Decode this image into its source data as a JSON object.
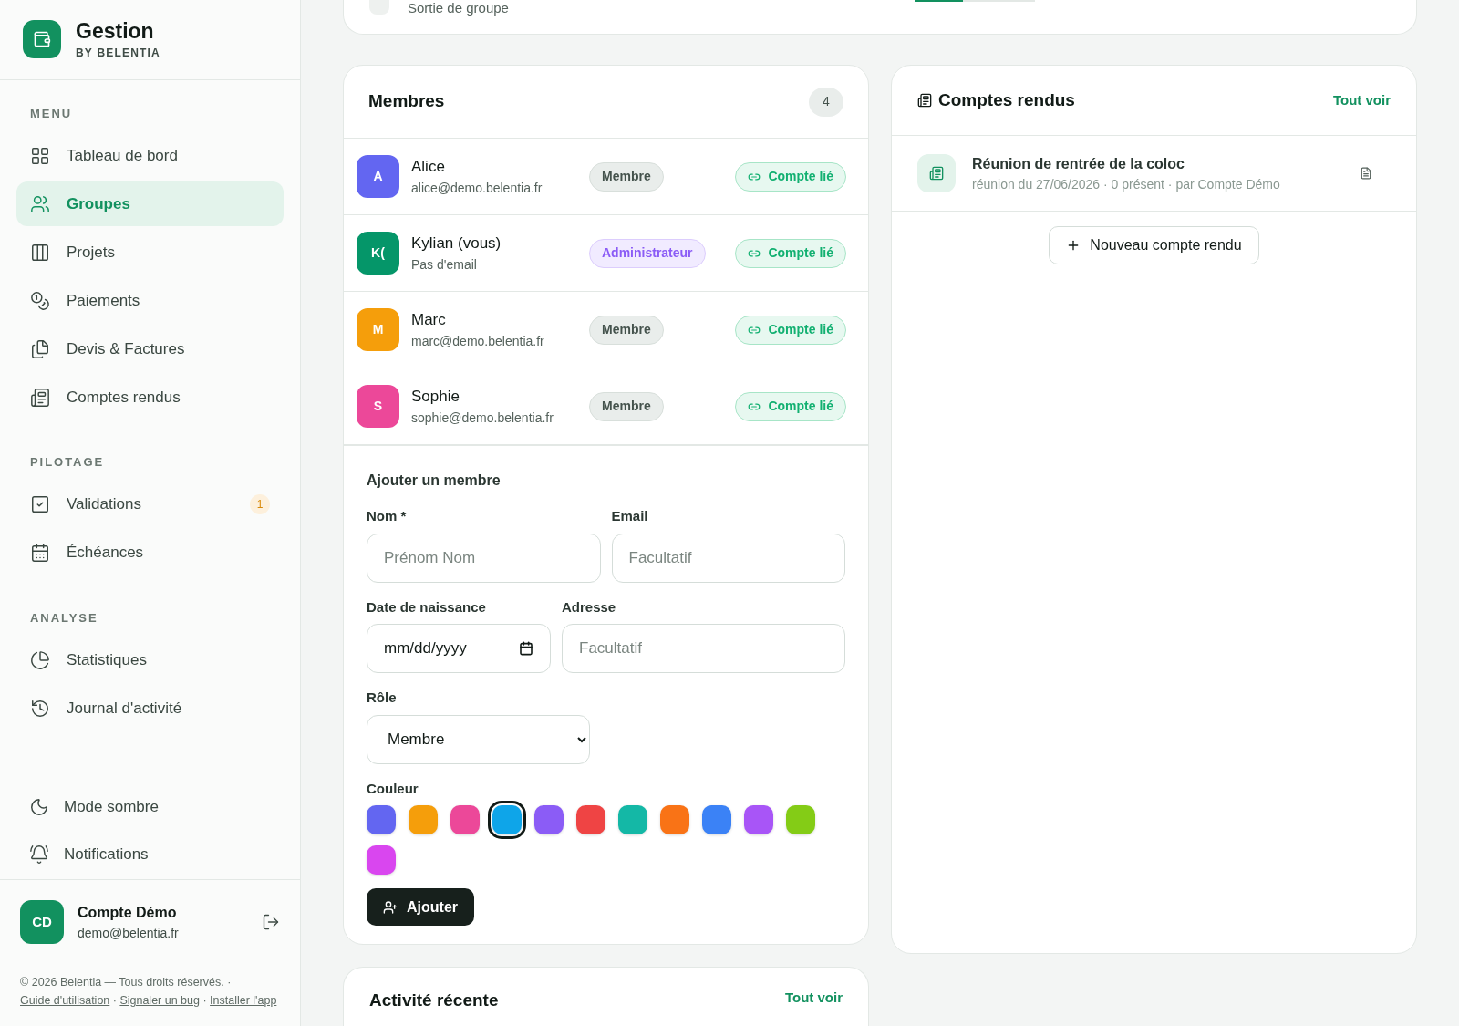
{
  "brand": {
    "title": "Gestion",
    "subtitle": "BY BELENTIA"
  },
  "sidebar": {
    "sections": [
      {
        "title": "MENU",
        "items": [
          {
            "label": "Tableau de bord",
            "selected": false
          },
          {
            "label": "Groupes",
            "selected": true
          },
          {
            "label": "Projets",
            "selected": false
          },
          {
            "label": "Paiements",
            "selected": false
          },
          {
            "label": "Devis & Factures",
            "selected": false
          },
          {
            "label": "Comptes rendus",
            "selected": false
          }
        ]
      },
      {
        "title": "PILOTAGE",
        "items": [
          {
            "label": "Validations",
            "selected": false,
            "badge": "1"
          },
          {
            "label": "Échéances",
            "selected": false
          }
        ]
      },
      {
        "title": "ANALYSE",
        "items": [
          {
            "label": "Statistiques",
            "selected": false
          },
          {
            "label": "Journal d'activité",
            "selected": false
          }
        ]
      }
    ],
    "utilities": [
      {
        "label": "Mode sombre"
      },
      {
        "label": "Notifications"
      }
    ],
    "account": {
      "initials": "CD",
      "name": "Compte Démo",
      "email": "demo@belentia.fr"
    },
    "footer": {
      "text": "© 2026 Belentia — Tous droits réservés.",
      "separator": "·",
      "links": [
        "Guide d'utilisation",
        "Signaler un bug",
        "Installer l'app"
      ]
    }
  },
  "top_row": {
    "label": "Sortie de groupe",
    "level": 0.4
  },
  "members": {
    "title": "Membres",
    "count": "4",
    "rows": [
      {
        "initials": "A",
        "name": "Alice",
        "email": "alice@demo.belentia.fr",
        "role": "Membre",
        "kind": "member",
        "link": "Compte lié",
        "color": "#6366f1"
      },
      {
        "initials": "K(",
        "name": "Kylian (vous)",
        "email": "Pas d'email",
        "role": "Administrateur",
        "kind": "admin",
        "link": "Compte lié",
        "color": "#059669"
      },
      {
        "initials": "M",
        "name": "Marc",
        "email": "marc@demo.belentia.fr",
        "role": "Membre",
        "kind": "member",
        "link": "Compte lié",
        "color": "#f59e0b"
      },
      {
        "initials": "S",
        "name": "Sophie",
        "email": "sophie@demo.belentia.fr",
        "role": "Membre",
        "kind": "member",
        "link": "Compte lié",
        "color": "#ec4899"
      }
    ]
  },
  "add_form": {
    "title": "Ajouter un membre",
    "name": {
      "label": "Nom *",
      "placeholder": "Prénom Nom"
    },
    "email": {
      "label": "Email",
      "placeholder": "Facultatif"
    },
    "birth": {
      "label": "Date de naissance",
      "placeholder": "mm/dd/yyyy"
    },
    "address": {
      "label": "Adresse",
      "placeholder": "Facultatif"
    },
    "role": {
      "label": "Rôle",
      "value": "Membre"
    },
    "color_label": "Couleur",
    "colors": [
      {
        "color": "#6366f1",
        "selected": false
      },
      {
        "color": "#f59e0b",
        "selected": false
      },
      {
        "color": "#ec4899",
        "selected": false
      },
      {
        "color": "#0ea5e9",
        "selected": true
      },
      {
        "color": "#8b5cf6",
        "selected": false
      },
      {
        "color": "#ef4444",
        "selected": false
      },
      {
        "color": "#14b8a6",
        "selected": false
      },
      {
        "color": "#f97316",
        "selected": false
      },
      {
        "color": "#3b82f6",
        "selected": false
      },
      {
        "color": "#a855f7",
        "selected": false
      },
      {
        "color": "#84cc16",
        "selected": false
      },
      {
        "color": "#d946ef",
        "selected": false
      }
    ],
    "submit": "Ajouter"
  },
  "reports": {
    "title": "Comptes rendus",
    "see_all": "Tout voir",
    "items": [
      {
        "title": "Réunion de rentrée de la coloc",
        "meta": "réunion du 27/06/2026 · 0 présent · par Compte Démo"
      }
    ],
    "new_button": "Nouveau compte rendu"
  },
  "activity": {
    "title": "Activité récente",
    "see_all": "Tout voir"
  }
}
